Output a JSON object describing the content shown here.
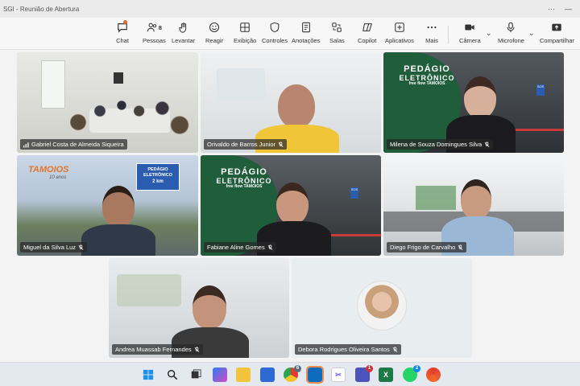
{
  "window": {
    "title": "SGI - Reunião de Abertura",
    "more": "···"
  },
  "toolbar": {
    "chat": "Chat",
    "people": "Pessoas",
    "people_count": "8",
    "raise": "Levantar",
    "react": "Reagir",
    "view": "Exibição",
    "controls": "Controles",
    "notes": "Anotações",
    "rooms": "Salas",
    "copilot": "Copilot",
    "apps": "Aplicativos",
    "more": "Mais",
    "camera": "Câmera",
    "mic": "Microfone",
    "share": "Compartilhar"
  },
  "participants": [
    {
      "name": "Gabriel Costa de Almeida Siqueira"
    },
    {
      "name": "Orivaldo de Barros Junior"
    },
    {
      "name": "Milena de Souza Domingues Silva"
    },
    {
      "name": "Miguel da Silva Luz"
    },
    {
      "name": "Fabiane Aline Gomes"
    },
    {
      "name": "Diego Frigo de Carvalho"
    },
    {
      "name": "Andrea Muassab Fernandes"
    },
    {
      "name": "Debora Rodrigues Oliveira Santos"
    }
  ],
  "backgrounds": {
    "pedagio_l1": "PEDÁGIO",
    "pedagio_l2": "ELETRÔNICO",
    "pedagio_l3": "free flow",
    "pedagio_brand": "TAMOIOS",
    "tamoios_logo": "TAMOIOS",
    "tamoios_sub": "10 anos",
    "sign_l1": "PEDÁGIO",
    "sign_l2": "ELETRÔNICO",
    "sign_km": "2 km",
    "sos": "SOS"
  },
  "taskbar": {
    "chrome_badge": "6",
    "teams_badge": "1",
    "whatsapp_badge": "2"
  },
  "colors": {
    "accent": "#464eb8",
    "pedagio_green": "#1f5d3b",
    "taskbar": "#e4e8ef"
  }
}
